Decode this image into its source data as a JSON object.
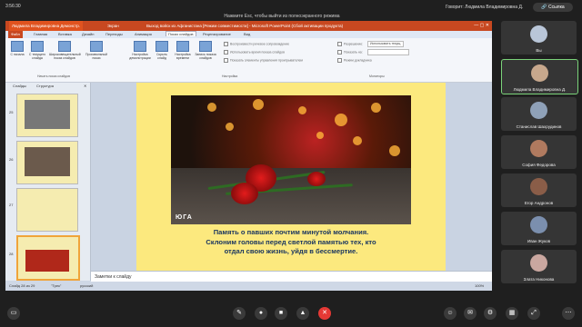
{
  "topbar": {
    "time": "3:56:30",
    "presenter": "Людмила Владимировна Демонстр.",
    "esc_hint": "Нажмите Esc, чтобы выйти из полноэкранного режима",
    "speaking": "Говорит: Людмила Владимировна Д.",
    "link_label": "Ссылка",
    "screen_label": "Экран"
  },
  "powerpoint": {
    "title": "Выход войск из Афганистана [Режим совместимости] - Microsoft PowerPoint (Сбой активации продукта)",
    "tabs": [
      "Файл",
      "Главная",
      "Вставка",
      "Дизайн",
      "Переходы",
      "Анимация",
      "Показ слайдов",
      "Рецензирование",
      "Вид"
    ],
    "ribbon": {
      "buttons": [
        "С начала",
        "С текущего слайда",
        "Широковещательный показ слайдов",
        "Произвольный показ",
        "Настройка демонстрации",
        "Скрыть слайд",
        "Настройка времени",
        "Запись показа слайдов"
      ],
      "checkboxes": [
        "Воспроизвести речевое сопровождение",
        "Использовать время показа слайдов",
        "Показать элементы управления проигрывателем"
      ],
      "right_items": [
        "Разрешение:",
        "Использовать текущ.",
        "Показать на:",
        "Режим докладчика"
      ],
      "groups": [
        "Начать показ слайдов",
        "Настройка",
        "Мониторы"
      ]
    },
    "left_panel": {
      "tabs": [
        "Слайды",
        "Структура"
      ],
      "slide_numbers": [
        "25",
        "26",
        "27",
        "28"
      ]
    },
    "slide": {
      "watermark": "ЮГА",
      "caption_lines": [
        "Память о павших  почтим минутой молчания.",
        "Склоним головы перед светлой памятью тех, кто",
        "отдал свою жизнь, уйдя в бессмертие."
      ]
    },
    "notes_placeholder": "Заметки к слайду",
    "status": {
      "slide_info": "Слайд 28 из 29",
      "theme": "\"Трек\"",
      "language": "русский",
      "zoom": "100%"
    }
  },
  "participants": [
    {
      "name": "Вы",
      "active": false,
      "color": "#b9c6d8"
    },
    {
      "name": "Людмила Владимировна Д.",
      "active": true,
      "color": "#c7a88d"
    },
    {
      "name": "Станислав Шахрудинов",
      "active": false,
      "color": "#8fa1b8"
    },
    {
      "name": "София Федорова",
      "active": false,
      "color": "#b07a5f"
    },
    {
      "name": "Егор Андронов",
      "active": false,
      "color": "#8a5d48"
    },
    {
      "name": "Иван Жуков",
      "active": false,
      "color": "#7b8fae"
    },
    {
      "name": "Злата Никонова",
      "active": false,
      "color": "#caa7a0"
    }
  ]
}
